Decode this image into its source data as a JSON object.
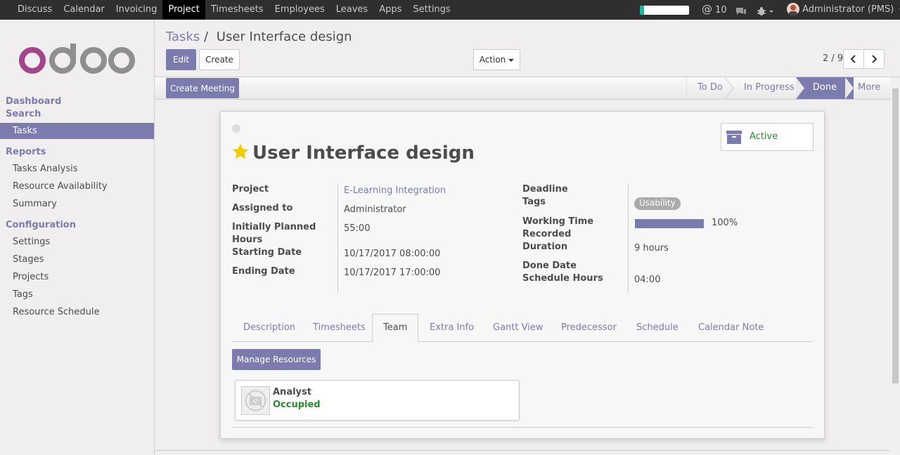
{
  "topbar": {
    "menu": [
      "Discuss",
      "Calendar",
      "Invoicing",
      "Project",
      "Timesheets",
      "Employees",
      "Leaves",
      "Apps",
      "Settings"
    ],
    "active_menu": "Project",
    "progress": 0.08,
    "mentions_count": "10",
    "user": "Administrator (PMS)"
  },
  "sidebar": {
    "logo_text": "odoo",
    "sections": {
      "dashboard": "Dashboard",
      "search": "Search",
      "tasks": "Tasks",
      "reports": "Reports",
      "configuration": "Configuration"
    },
    "reports_items": [
      "Tasks Analysis",
      "Resource Availability",
      "Summary"
    ],
    "config_items": [
      "Settings",
      "Stages",
      "Projects",
      "Tags",
      "Resource Schedule"
    ]
  },
  "control_panel": {
    "breadcrumb_parent": "Tasks",
    "breadcrumb_sep": "/",
    "breadcrumb_current": "User Interface design",
    "edit_label": "Edit",
    "create_label": "Create",
    "action_label": "Action",
    "pager": "2 / 9"
  },
  "statusbar": {
    "create_meeting_label": "Create Meeting",
    "stages": [
      "To Do",
      "In Progress",
      "Done",
      "More"
    ],
    "current_stage": "Done"
  },
  "form": {
    "title": "User Interface design",
    "active_label": "Active",
    "left_fields": {
      "project_label": "Project",
      "project_value": "E-Learning Integration",
      "assigned_label": "Assigned to",
      "assigned_value": "Administrator",
      "planned_label_1": "Initially Planned",
      "planned_label_2": "Hours",
      "planned_value": "55:00",
      "start_label": "Starting Date",
      "start_value": "10/17/2017 08:00:00",
      "end_label": "Ending Date",
      "end_value": "10/17/2017 17:00:00"
    },
    "right_fields": {
      "deadline_label": "Deadline",
      "tags_label": "Tags",
      "tag_value": "Usability",
      "working_label_1": "Working Time",
      "working_label_2": "Recorded",
      "working_value": "100%",
      "duration_label": "Duration",
      "duration_value": "9 hours",
      "done_label": "Done Date",
      "schedule_label": "Schedule Hours",
      "schedule_value": "04:00"
    },
    "tabs": [
      "Description",
      "Timesheets",
      "Team",
      "Extra Info",
      "Gantt View",
      "Predecessor",
      "Schedule",
      "Calendar Note"
    ],
    "active_tab": "Team",
    "manage_resources_label": "Manage Resources",
    "resource": {
      "name": "Analyst",
      "status": "Occupied"
    }
  },
  "colors": {
    "accent": "#7c7bad",
    "topbar": "#2f2f2f",
    "occupied": "#2b8a2b",
    "star": "#f3cc00"
  }
}
